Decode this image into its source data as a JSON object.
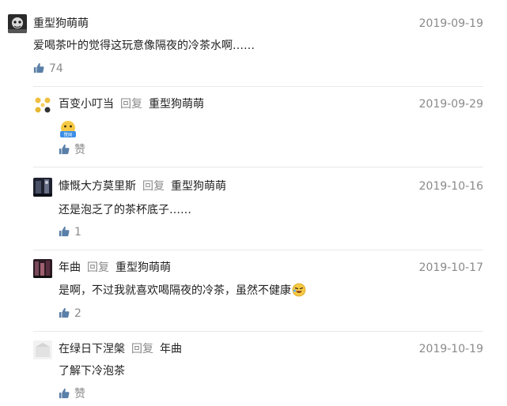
{
  "comments": [
    {
      "user": "重型狗萌萌",
      "date": "2019-09-19",
      "text": "爱喝茶叶的觉得这玩意像隔夜的冷茶水啊……",
      "likes": "74"
    }
  ],
  "replies": [
    {
      "user": "百变小叮当",
      "reply_word": "回复",
      "reply_to": "重型狗萌萌",
      "date": "2019-09-29",
      "sticker": "赞同",
      "likes": "赞"
    },
    {
      "user": "慷慨大方莫里斯",
      "reply_word": "回复",
      "reply_to": "重型狗萌萌",
      "date": "2019-10-16",
      "text": "还是泡乏了的茶杯底子……",
      "likes": "1"
    },
    {
      "user": "年曲",
      "reply_word": "回复",
      "reply_to": "重型狗萌萌",
      "date": "2019-10-17",
      "text": "是啊，不过我就喜欢喝隔夜的冷茶，虽然不健康",
      "likes": "2"
    },
    {
      "user": "在绿日下涅槃",
      "reply_word": "回复",
      "reply_to": "年曲",
      "date": "2019-10-19",
      "text": "了解下冷泡茶",
      "likes": "赞"
    }
  ],
  "colors": {
    "text": "#222222",
    "muted": "#8a8a8a",
    "divider": "#e8e8e8"
  }
}
